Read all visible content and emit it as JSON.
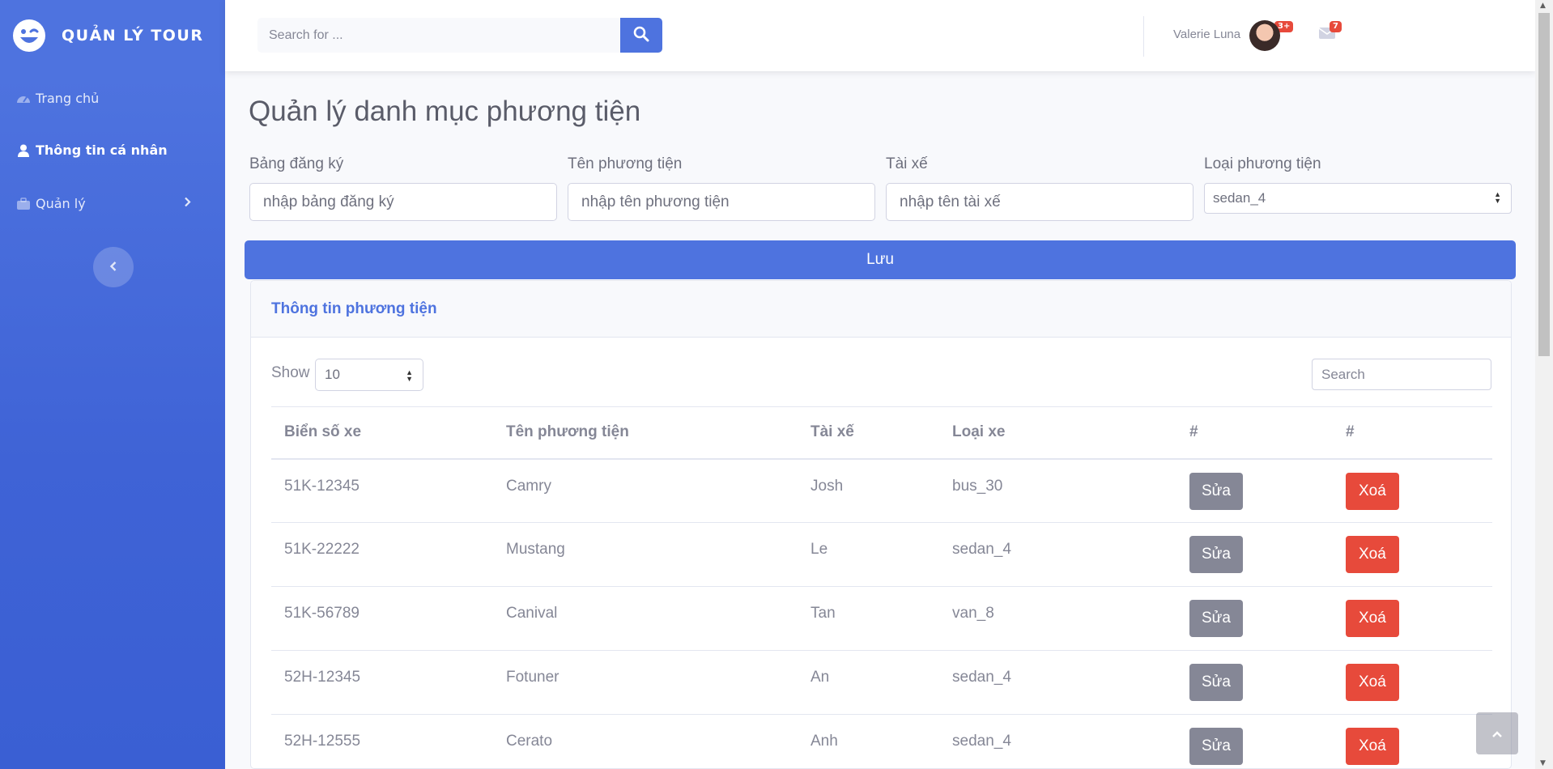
{
  "brand": {
    "name": "QUẢN LÝ TOUR"
  },
  "sidebar": {
    "items": [
      {
        "label": "Trang chủ",
        "icon": "dashboard-icon"
      },
      {
        "label": "Thông tin cá nhân",
        "icon": "user-icon"
      },
      {
        "label": "Quản lý",
        "icon": "briefcase-icon"
      }
    ]
  },
  "topbar": {
    "search_placeholder": "Search for ...",
    "alerts_badge": "3+",
    "messages_badge": "7",
    "user_name": "Valerie Luna"
  },
  "page": {
    "title": "Quản lý danh mục phương tiện"
  },
  "form": {
    "plate_label": "Bảng đăng ký",
    "plate_placeholder": "nhập bảng đăng ký",
    "name_label": "Tên phương tiện",
    "name_placeholder": "nhập tên phương tiện",
    "driver_label": "Tài xế",
    "driver_placeholder": "nhập tên tài xế",
    "type_label": "Loại phương tiện",
    "type_value": "sedan_4",
    "save_label": "Lưu"
  },
  "card": {
    "title": "Thông tin phương tiện",
    "show_label": "Show",
    "show_value": "10",
    "search_placeholder": "Search"
  },
  "table": {
    "headers": [
      "Biển số xe",
      "Tên phương tiện",
      "Tài xế",
      "Loại xe",
      "#",
      "#"
    ],
    "edit_label": "Sửa",
    "delete_label": "Xoá",
    "rows": [
      {
        "plate": "51K-12345",
        "name": "Camry",
        "driver": "Josh",
        "type": "bus_30"
      },
      {
        "plate": "51K-22222",
        "name": "Mustang",
        "driver": "Le",
        "type": "sedan_4"
      },
      {
        "plate": "51K-56789",
        "name": "Canival",
        "driver": "Tan",
        "type": "van_8"
      },
      {
        "plate": "52H-12345",
        "name": "Fotuner",
        "driver": "An",
        "type": "sedan_4"
      },
      {
        "plate": "52H-12555",
        "name": "Cerato",
        "driver": "Anh",
        "type": "sedan_4"
      }
    ]
  },
  "colors": {
    "primary": "#4e73df",
    "danger": "#e74a3b",
    "secondary": "#858796"
  }
}
